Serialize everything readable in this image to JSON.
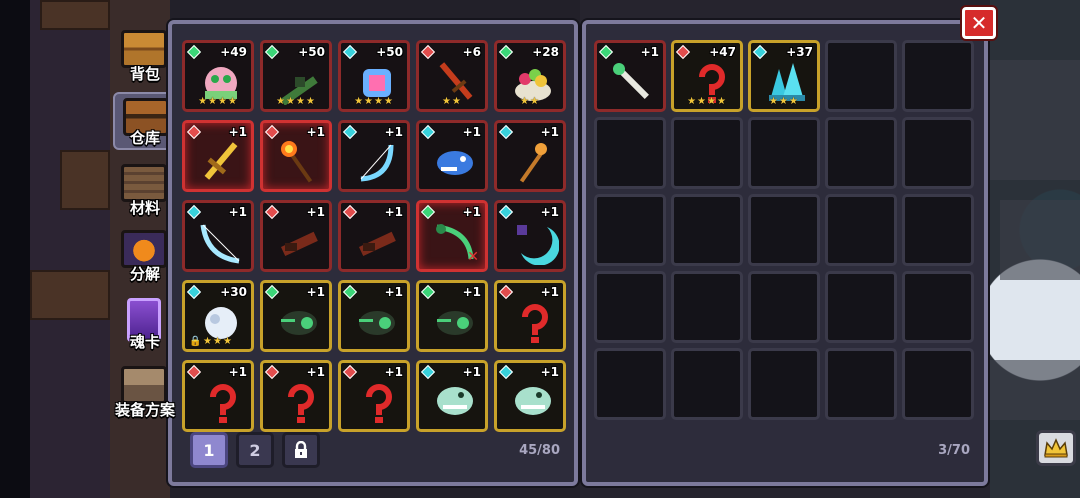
{
  "side_tabs": [
    {
      "label": "背包",
      "icon": "chest-icon",
      "active": false
    },
    {
      "label": "仓库",
      "icon": "warehouse-chest-icon",
      "active": true
    },
    {
      "label": "材料",
      "icon": "materials-crate-icon",
      "active": false
    },
    {
      "label": "分解",
      "icon": "pumpkin-cauldron-icon",
      "active": false
    },
    {
      "label": "魂卡",
      "icon": "soul-card-icon",
      "active": false
    },
    {
      "label": "装备方案",
      "icon": "armor-loadout-icon",
      "active": false
    }
  ],
  "left_panel": {
    "pages": [
      "1",
      "2"
    ],
    "active_page": "1",
    "lock_icon": "lock-icon",
    "capacity": "45/80",
    "items": [
      {
        "gem": "green",
        "count": "+49",
        "stars": "★★★★",
        "frame": "red",
        "icon": "pig-mount-icon"
      },
      {
        "gem": "green",
        "count": "+50",
        "stars": "★★★★",
        "frame": "red",
        "icon": "green-rifle-icon"
      },
      {
        "gem": "cyan",
        "count": "+50",
        "stars": "★★★★",
        "frame": "red",
        "icon": "rainbow-staff-icon"
      },
      {
        "gem": "red",
        "count": "+6",
        "stars": "★★",
        "frame": "red",
        "icon": "flame-sword-icon"
      },
      {
        "gem": "green",
        "count": "+28",
        "stars": "★★",
        "frame": "red",
        "icon": "fruit-bowl-icon"
      },
      {
        "gem": "red",
        "count": "+1",
        "stars": "",
        "frame": "redglow",
        "icon": "golden-sword-icon"
      },
      {
        "gem": "red",
        "count": "+1",
        "stars": "",
        "frame": "redglow",
        "icon": "fire-wand-icon"
      },
      {
        "gem": "cyan",
        "count": "+1",
        "stars": "",
        "frame": "red",
        "icon": "ice-bow-icon"
      },
      {
        "gem": "cyan",
        "count": "+1",
        "stars": "",
        "frame": "red",
        "icon": "shark-gun-icon"
      },
      {
        "gem": "cyan",
        "count": "+1",
        "stars": "",
        "frame": "red",
        "icon": "orange-staff-icon"
      },
      {
        "gem": "cyan",
        "count": "+1",
        "stars": "",
        "frame": "red",
        "icon": "frost-bow-icon"
      },
      {
        "gem": "red",
        "count": "+1",
        "stars": "",
        "frame": "red",
        "icon": "dark-claw-icon"
      },
      {
        "gem": "red",
        "count": "+1",
        "stars": "",
        "frame": "red",
        "icon": "dark-claw-icon"
      },
      {
        "gem": "green",
        "count": "+1",
        "stars": "",
        "frame": "redglow",
        "icon": "serpent-bow-icon",
        "marked": true
      },
      {
        "gem": "cyan",
        "count": "+1",
        "stars": "",
        "frame": "red",
        "icon": "moon-scythe-icon"
      },
      {
        "gem": "cyan",
        "count": "+30",
        "stars": "★★★",
        "frame": "gold",
        "icon": "snow-orb-icon",
        "locked": true
      },
      {
        "gem": "green",
        "count": "+1",
        "stars": "",
        "frame": "gold",
        "icon": "green-beetle-icon"
      },
      {
        "gem": "green",
        "count": "+1",
        "stars": "",
        "frame": "gold",
        "icon": "green-beetle-icon"
      },
      {
        "gem": "green",
        "count": "+1",
        "stars": "",
        "frame": "gold",
        "icon": "green-beetle-icon"
      },
      {
        "gem": "red",
        "count": "+1",
        "stars": "",
        "frame": "gold",
        "icon": "red-hook-icon"
      },
      {
        "gem": "red",
        "count": "+1",
        "stars": "",
        "frame": "gold",
        "icon": "red-hook-icon"
      },
      {
        "gem": "red",
        "count": "+1",
        "stars": "",
        "frame": "gold",
        "icon": "red-hook-icon"
      },
      {
        "gem": "red",
        "count": "+1",
        "stars": "",
        "frame": "gold",
        "icon": "red-hook-icon"
      },
      {
        "gem": "cyan",
        "count": "+1",
        "stars": "",
        "frame": "gold",
        "icon": "ghost-fish-icon"
      },
      {
        "gem": "cyan",
        "count": "+1",
        "stars": "",
        "frame": "gold",
        "icon": "ghost-fish-icon"
      }
    ]
  },
  "right_panel": {
    "capacity": "3/70",
    "items": [
      {
        "gem": "green",
        "count": "+1",
        "stars": "",
        "frame": "red",
        "icon": "bone-staff-icon"
      },
      {
        "gem": "red",
        "count": "+47",
        "stars": "★★★★",
        "frame": "gold",
        "icon": "red-hook-icon"
      },
      {
        "gem": "cyan",
        "count": "+37",
        "stars": "★★★",
        "frame": "gold",
        "icon": "ice-crystal-icon"
      }
    ]
  },
  "close_button": {
    "glyph": "✕",
    "icon": "close-icon"
  },
  "crown_button": {
    "icon": "crown-icon"
  },
  "colors": {
    "panel_bg": "#2d2c3b",
    "panel_border": "#7d7a9c",
    "frame_red": "#8e2a2a",
    "frame_gold": "#c8a22a",
    "gem_green": "#3bd678",
    "gem_red": "#e24d4d",
    "gem_cyan": "#38d2dc",
    "star": "#f1c53a",
    "close_red": "#d62b2b"
  }
}
